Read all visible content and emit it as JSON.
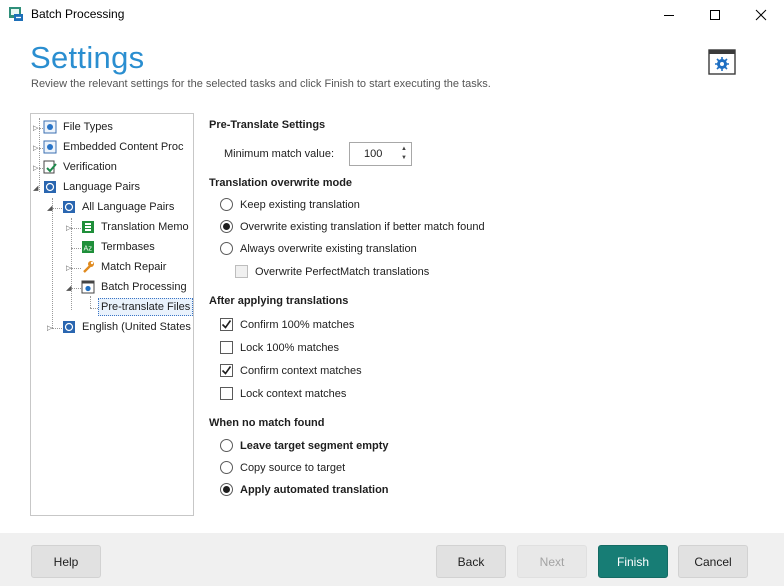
{
  "window": {
    "title": "Batch Processing",
    "icons": {
      "app": "batch-processing-icon",
      "minimize": "minimize-icon",
      "maximize": "maximize-icon",
      "close": "close-icon"
    }
  },
  "header": {
    "heading": "Settings",
    "subtitle": "Review the relevant settings for the selected tasks and click Finish to start executing the tasks.",
    "badge_icon": "settings-window-icon",
    "accent_color": "#2a8ed0"
  },
  "tree": {
    "file_types": "File Types",
    "embedded_content": "Embedded Content Proc",
    "verification": "Verification",
    "language_pairs": "Language Pairs",
    "all_language_pairs": "All Language Pairs",
    "translation_memory": "Translation Memo",
    "termbases": "Termbases",
    "match_repair": "Match Repair",
    "batch_processing": "Batch Processing",
    "pretranslate_files": "Pre-translate Files",
    "english_us": "English (United States"
  },
  "pretranslate": {
    "section_title": "Pre-Translate Settings",
    "min_match_label": "Minimum match value:",
    "min_match_value": "100"
  },
  "overwrite_mode": {
    "title": "Translation overwrite mode",
    "options": [
      "Keep existing translation",
      "Overwrite existing translation if better match found",
      "Always overwrite existing translation"
    ],
    "selected_index": 1,
    "perfect_match_label": "Overwrite PerfectMatch translations",
    "perfect_match_checked": false
  },
  "after_applying": {
    "title": "After applying translations",
    "items": [
      {
        "label": "Confirm 100% matches",
        "checked": true
      },
      {
        "label": "Lock 100% matches",
        "checked": false
      },
      {
        "label": "Confirm context matches",
        "checked": true
      },
      {
        "label": "Lock context matches",
        "checked": false
      }
    ]
  },
  "no_match": {
    "title": "When no match found",
    "options": [
      "Leave target segment empty",
      "Copy source to target",
      "Apply automated translation"
    ],
    "selected_index": 2
  },
  "footer": {
    "help": "Help",
    "back": "Back",
    "next": "Next",
    "finish": "Finish",
    "cancel": "Cancel",
    "finish_color": "#177d75"
  }
}
